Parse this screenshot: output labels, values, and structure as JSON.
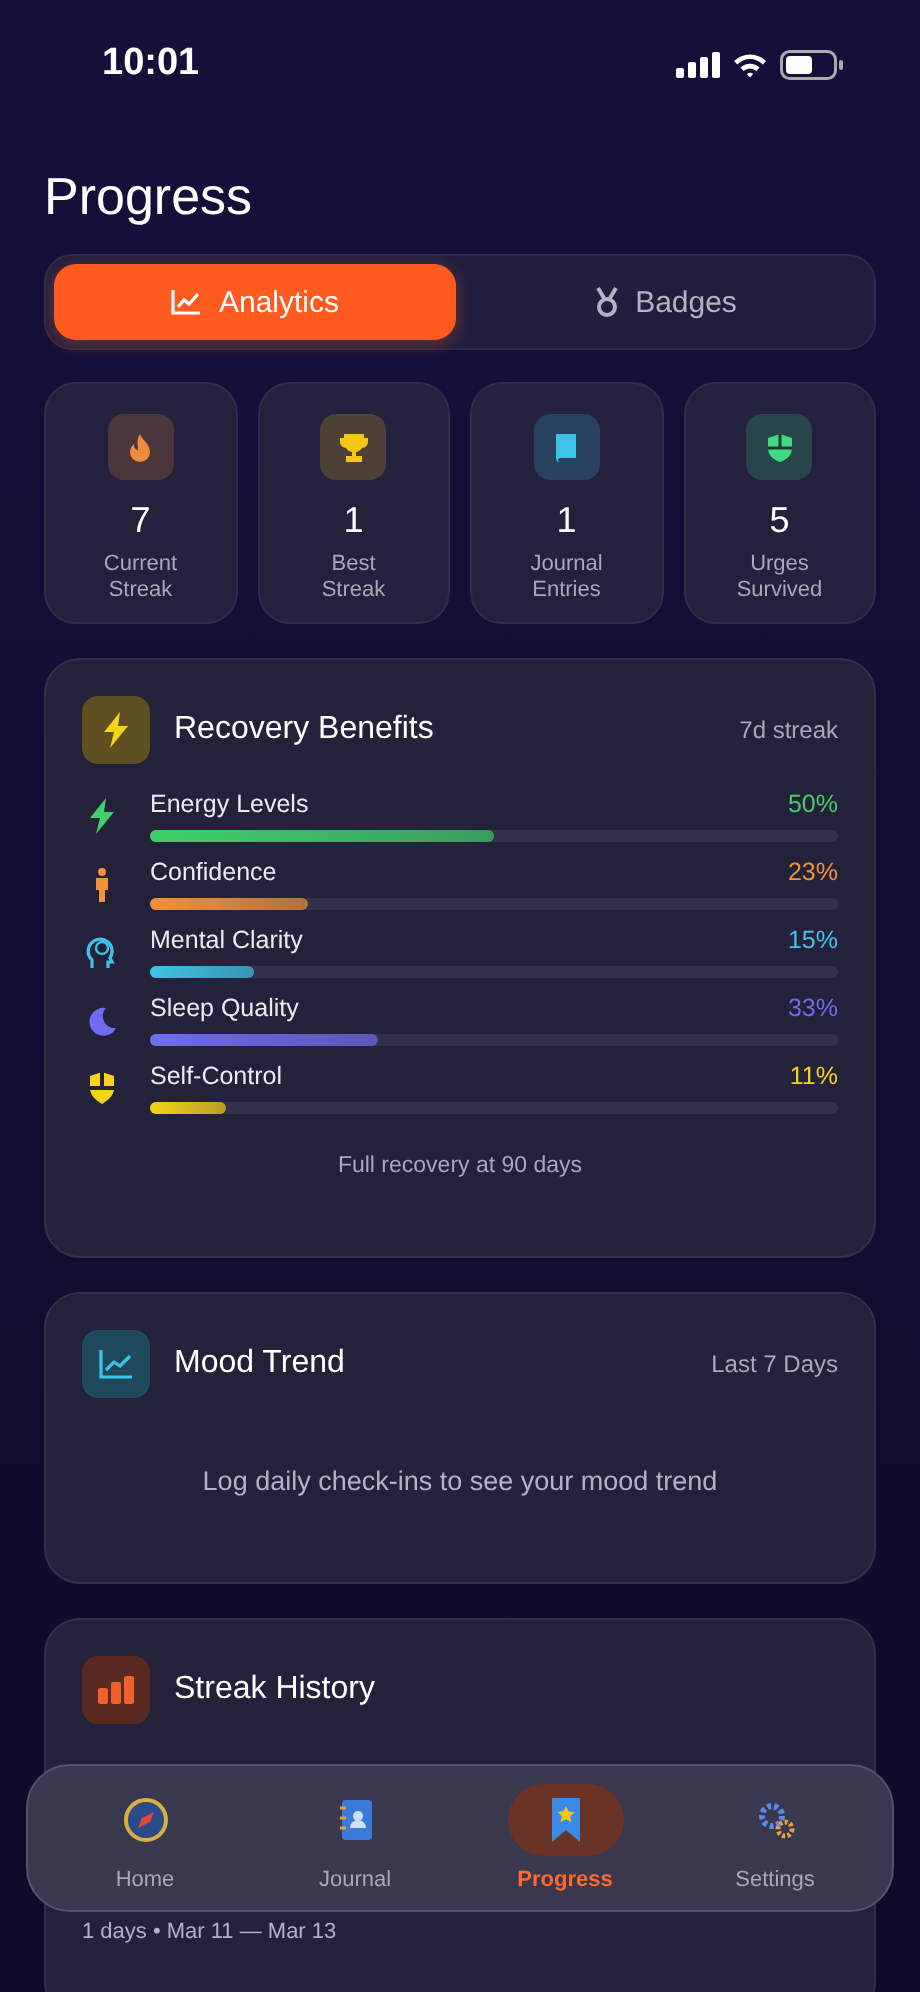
{
  "status_bar": {
    "time": "10:01"
  },
  "title": "Progress",
  "tabs": [
    {
      "label": "Analytics",
      "selected": true
    },
    {
      "label": "Badges",
      "selected": false
    }
  ],
  "stats": [
    {
      "value": "7",
      "label": "Current Streak",
      "color": "#f08a3c"
    },
    {
      "value": "1",
      "label": "Best Streak",
      "color": "#f5c518"
    },
    {
      "value": "1",
      "label": "Journal Entries",
      "color": "#3ec3e8"
    },
    {
      "value": "5",
      "label": "Urges Survived",
      "color": "#3ddc84"
    }
  ],
  "benefits": {
    "title": "Recovery Benefits",
    "badge": "7d streak",
    "footer": "Full recovery at 90 days",
    "items": [
      {
        "name": "Energy Levels",
        "reading": "50%",
        "level": 0.5,
        "color": "#3fd06a"
      },
      {
        "name": "Confidence",
        "reading": "23%",
        "level": 0.23,
        "color": "#f0913c"
      },
      {
        "name": "Mental Clarity",
        "reading": "15%",
        "level": 0.15,
        "color": "#3ec3e8"
      },
      {
        "name": "Sleep Quality",
        "reading": "33%",
        "level": 0.33,
        "color": "#6f6cf0"
      },
      {
        "name": "Self-Control",
        "reading": "11%",
        "level": 0.11,
        "color": "#f5d418"
      }
    ]
  },
  "mood": {
    "title": "Mood Trend",
    "range": "Last 7 Days",
    "message": "Log daily check-ins to see your mood trend"
  },
  "history": {
    "title": "Streak History",
    "dates_line": "1 days • Mar 11 — Mar 13"
  },
  "nav": [
    {
      "label": "Home",
      "selected": false
    },
    {
      "label": "Journal",
      "selected": false
    },
    {
      "label": "Progress",
      "selected": true
    },
    {
      "label": "Settings",
      "selected": false
    }
  ]
}
